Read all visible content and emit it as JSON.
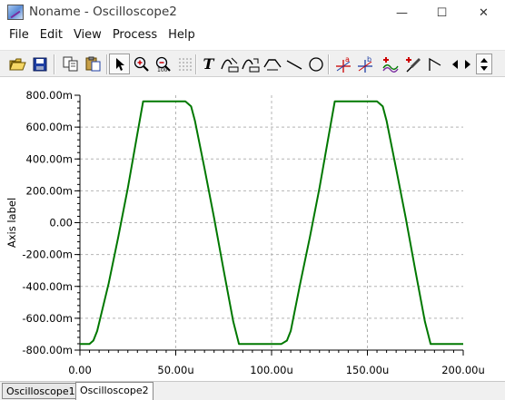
{
  "window": {
    "title": "Noname - Oscilloscope2",
    "minimize_glyph": "—",
    "maximize_glyph": "☐",
    "close_glyph": "✕"
  },
  "menu": [
    "File",
    "Edit",
    "View",
    "Process",
    "Help"
  ],
  "toolbar": {
    "buttons": [
      "open-folder-icon",
      "save-icon",
      "copy-icon",
      "paste-icon",
      "pointer-icon",
      "zoom-in-icon",
      "zoom-out-icon",
      "zoom-100-icon",
      "grid-dots-icon",
      "text-tool-icon",
      "curve-a-icon",
      "curve-b-icon",
      "curve-c-icon",
      "line-tool-icon",
      "circle-tool-icon",
      "cursor-a-icon",
      "cursor-b-icon",
      "add-waveform-icon",
      "probe-icon",
      "step-icon",
      "scroll-left-icon",
      "scroll-right-icon",
      "scroll-updown-icon"
    ],
    "text_tool_glyph": "T",
    "zoom_100_label": "100",
    "cursor_a_label": "a",
    "cursor_b_label": "b"
  },
  "colors": {
    "trace": "#007800",
    "grid": "#b4b4b4",
    "window_bg": "#ffffff",
    "toolbar_bg": "#f0f0f0"
  },
  "chart_data": {
    "type": "line",
    "ylabel": "Axis label",
    "xlabel": "",
    "xlim": [
      0,
      200
    ],
    "ylim": [
      -800,
      800
    ],
    "x_ticks": [
      0,
      50,
      100,
      150,
      200
    ],
    "x_tick_labels": [
      "0.00",
      "50.00u",
      "100.00u",
      "150.00u",
      "200.00u"
    ],
    "y_ticks": [
      800,
      600,
      400,
      200,
      0,
      -200,
      -400,
      -600,
      -800
    ],
    "y_tick_labels": [
      "800.00m",
      "600.00m",
      "400.00m",
      "200.00m",
      "0.00",
      "-200.00m",
      "-400.00m",
      "-600.00m",
      "-800.00m"
    ],
    "grid": true,
    "series": [
      {
        "x": [
          0,
          5,
          7,
          9,
          15,
          20,
          25,
          30,
          33,
          55,
          58,
          60,
          65,
          70,
          75,
          80,
          83,
          105,
          108,
          110,
          115,
          120,
          125,
          130,
          133,
          155,
          158,
          160,
          165,
          170,
          175,
          180,
          183,
          200
        ],
        "y": [
          -762,
          -762,
          -740,
          -680,
          -380,
          -90,
          220,
          560,
          762,
          762,
          730,
          640,
          340,
          30,
          -300,
          -620,
          -762,
          -762,
          -740,
          -680,
          -380,
          -90,
          220,
          560,
          762,
          762,
          730,
          640,
          340,
          30,
          -300,
          -620,
          -762,
          -762
        ]
      }
    ]
  },
  "tabs": [
    "Oscilloscope1",
    "Oscilloscope2"
  ]
}
